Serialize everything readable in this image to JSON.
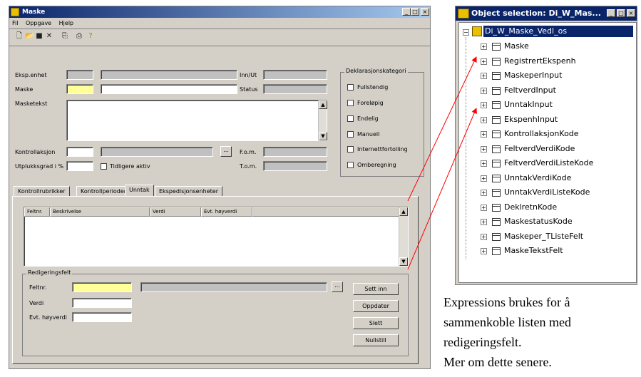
{
  "window": {
    "title": "Maske",
    "menu": [
      "Fil",
      "Oppgave",
      "Hjelp"
    ],
    "toolbar_icons": [
      "new-icon",
      "open-icon",
      "save-icon",
      "delete-icon",
      "copy-icon",
      "print-icon",
      "help-icon"
    ]
  },
  "form": {
    "eksp_enhet_label": "Eksp.enhet",
    "maske_label": "Maske",
    "masketekst_label": "Masketekst",
    "kontrollaksjon_label": "Kontrollaksjon",
    "utplukk_label": "Utplukksgrad i %",
    "tidligere_aktiv_label": "Tidligere aktiv",
    "inn_ut_label": "Inn/Ut",
    "status_label": "Status",
    "fom_label": "F.o.m.",
    "tom_label": "T.o.m.",
    "ellipsis": "..."
  },
  "deklarasjon": {
    "title": "Deklarasjonskategori",
    "options": [
      "Fullstendig",
      "Foreløpig",
      "Endelig",
      "Manuell",
      "Internettfortolling",
      "Omberegning"
    ]
  },
  "tabs": [
    "Kontrollrubrikker",
    "Kontrollperioder",
    "Unntak",
    "Ekspedisjonsenheter"
  ],
  "active_tab": "Unntak",
  "table": {
    "columns": [
      "Feltnr.",
      "Beskrivelse",
      "Verdi",
      "Evt. høyverdi"
    ]
  },
  "redigering": {
    "title": "Redigeringsfelt",
    "feltnr_label": "Feltnr.",
    "verdi_label": "Verdi",
    "hoyverdi_label": "Evt. høyverdi",
    "ellipsis": "...",
    "buttons": [
      "Sett inn",
      "Oppdater",
      "Slett",
      "Nullstill"
    ]
  },
  "object_selection": {
    "title": "Object selection: Di_W_Mas...",
    "root": "Di_W_Maske_Vedl_os",
    "items": [
      "Maske",
      "RegistrertEkspenh",
      "MaskeperInput",
      "FeltverdInput",
      "UnntakInput",
      "EkspenhInput",
      "KontrollaksjonKode",
      "FeltverdVerdiKode",
      "FeltverdVerdiListeKode",
      "UnntakVerdiKode",
      "UnntakVerdiListeKode",
      "DeklretnKode",
      "MaskestatusKode",
      "Maskeper_TListeFelt",
      "MaskeTekstFelt"
    ]
  },
  "caption": [
    "Expressions brukes for å",
    "sammenkoble listen med",
    "redigeringsfelt.",
    "Mer om dette senere."
  ],
  "colors": {
    "arrow": "#ff0000",
    "titlebar": "#0a246a",
    "highlight": "#ffff99"
  }
}
